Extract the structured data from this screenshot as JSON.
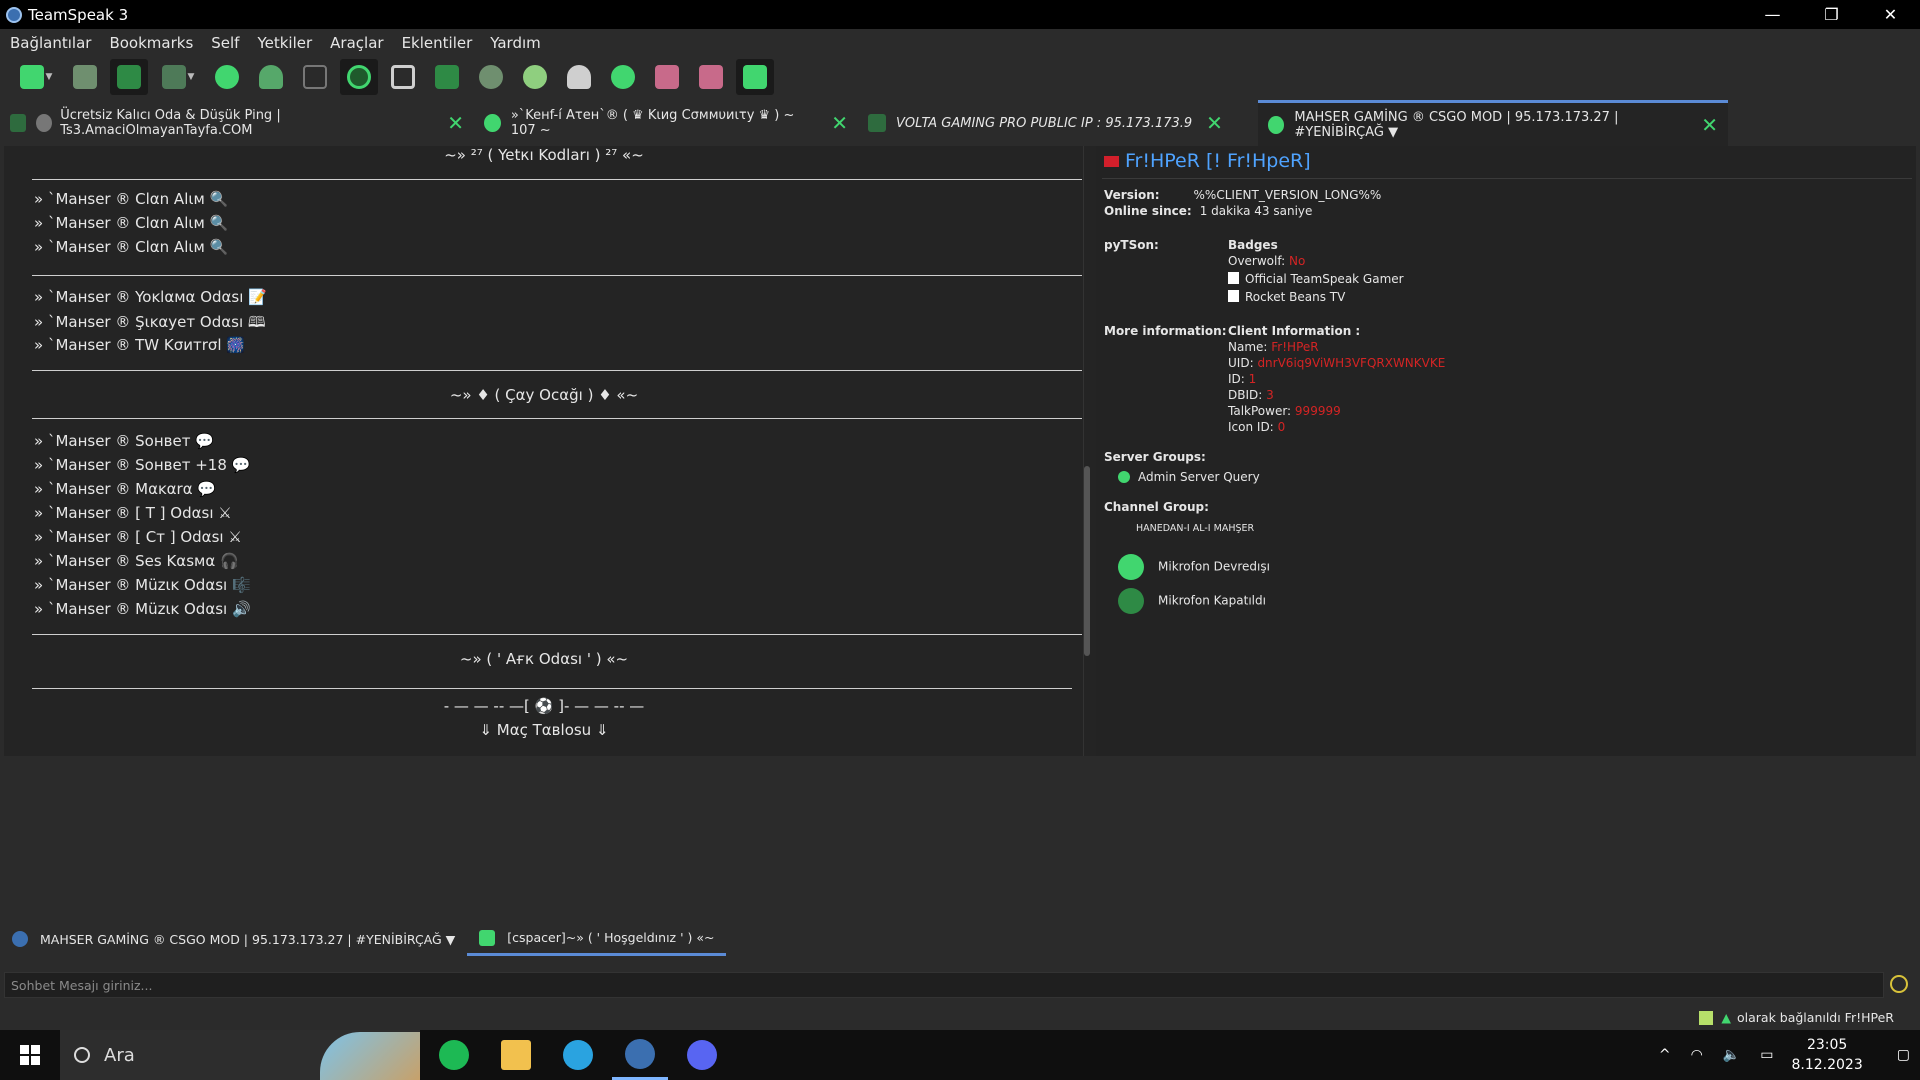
{
  "window": {
    "title": "TeamSpeak 3",
    "controls": [
      "—",
      "❐",
      "✕"
    ]
  },
  "menu": [
    "Bağlantılar",
    "Bookmarks",
    "Self",
    "Yetkiler",
    "Araçlar",
    "Eklentiler",
    "Yardım"
  ],
  "toolbar": {
    "icons": [
      "connect-icon",
      "disconnect-icon",
      "away-icon",
      "mute-sound-icon",
      "talk-icon",
      "contacts-icon",
      "bat-icon",
      "record-icon",
      "window-icon",
      "ban-icon",
      "mic-off-icon",
      "mic-on-icon",
      "add-user-icon",
      "settings-gear-icon",
      "poke-c-icon",
      "poke-s-icon",
      "status-icon"
    ],
    "colors": {
      "green": "#41d66f",
      "pink": "#c86a8a",
      "gray": "#cfcfcf"
    }
  },
  "tabs": [
    {
      "label": "Ücretsiz Kalıcı Oda & Düşük Ping | Ts3.AmaciOlmayanTayfa.COM",
      "close": "✕"
    },
    {
      "label": "»`Keнf-í Aτeн`® ( ♛ Kιиg Cσммυиιτу ♛ ) ~ 107 ~",
      "close": "✕"
    },
    {
      "label": "VOLTA GAMING PRO PUBLIC IP : 95.173.173.9",
      "close": "✕"
    },
    {
      "label": "MAHSER GAMİNG ® CSGO MOD | 95.173.173.27 | #YENİBİRÇAĞ ▼",
      "close": "✕"
    }
  ],
  "channels": {
    "header1": "~» ²⁷ ( Yetкı Kodları ) ²⁷ «~",
    "group1": [
      "» `Mанser ® Clαn Alιм 🔍",
      "» `Mанser ® Clαn Alιм 🔍",
      "» `Mанser ® Clαn Alιм 🔍"
    ],
    "group2": [
      "» `Mанser ® Yoĸlαмα Odαsı 📝",
      "» `Mанser ® Şιĸαyeт Odαsı 🕮",
      "» `Mанser ® TW Kσитrσl 🎆"
    ],
    "header2": "~» ♦ ( Çαу Ocαğı ) ♦ «~",
    "group3": [
      "» `Mанser ® Soнвeт 💬",
      "» `Mанser ® Soнвeт +18 💬",
      "» `Mанser ® Mαĸαrα 💬",
      "» `Mанser ® [ T ] Odαsı ⚔",
      "» `Mанser ® [ Cт ] Odαsı ⚔",
      "» `Mанser ® Ses Kαѕмα 🎧",
      "» `Mанser ® Müzιĸ Odαsı 🎼",
      "» `Mанser ® Müzιĸ Odαsı 🔊"
    ],
    "header3": "~» ( ' Aғк Odαsı ' ) «~",
    "header4": "- — — -- —[ ⚽ ]- — — -- —",
    "header5": "⇓ Mαç Tαвlosu ⇓"
  },
  "client": {
    "name": "Fr!HPeR [!                    Fr!HpeR]",
    "version_label": "Version:",
    "version": "%%CLIENT_VERSION_LONG%%",
    "online_label": "Online since:",
    "online": "1 dakika 43 saniye",
    "pytson_label": "pyTSon:",
    "badges_label": "Badges",
    "overwolf_label": "Overwolf:",
    "overwolf": "No",
    "badge1": "Official TeamSpeak Gamer",
    "badge2": "Rocket Beans TV",
    "more_label": "More information:",
    "client_info_label": "Client Information :",
    "name_label": "Name:",
    "name_value": "Fr!HPeR",
    "uid_label": "UID:",
    "uid_value": "dnrV6iq9ViWH3VFQRXWNKVKE",
    "id_label": "ID:",
    "id_value": "1",
    "dbid_label": "DBID:",
    "dbid_value": "3",
    "talkpower_label": "TalkPower:",
    "talkpower_value": "999999",
    "iconid_label": "Icon ID:",
    "iconid_value": "0",
    "server_groups_label": "Server Groups:",
    "server_group": "Admin Server Query",
    "channel_group_label": "Channel Group:",
    "channel_group": "HANEDAN-I AL-I MAHŞER",
    "mic1": "Mikrofon Devredışı",
    "mic2": "Mikrofon Kapatıldı"
  },
  "bottom_tabs": [
    {
      "label": "MAHSER GAMİNG ® CSGO MOD | 95.173.173.27 | #YENİBİRÇAĞ ▼"
    },
    {
      "label": "[cspacer]~» ( ' Hoşgeldınız ' ) «~"
    }
  ],
  "chat": {
    "placeholder": "Sohbet Mesajı giriniz..."
  },
  "status": {
    "text": "olarak bağlanıldı Fr!HPeR"
  },
  "taskbar": {
    "search_label": "Ara",
    "apps": [
      "spotify-icon",
      "file-explorer-icon",
      "edge-icon",
      "teamspeak-icon",
      "discord-icon"
    ],
    "tray_caret": "^",
    "time": "23:05",
    "date": "8.12.2023"
  }
}
